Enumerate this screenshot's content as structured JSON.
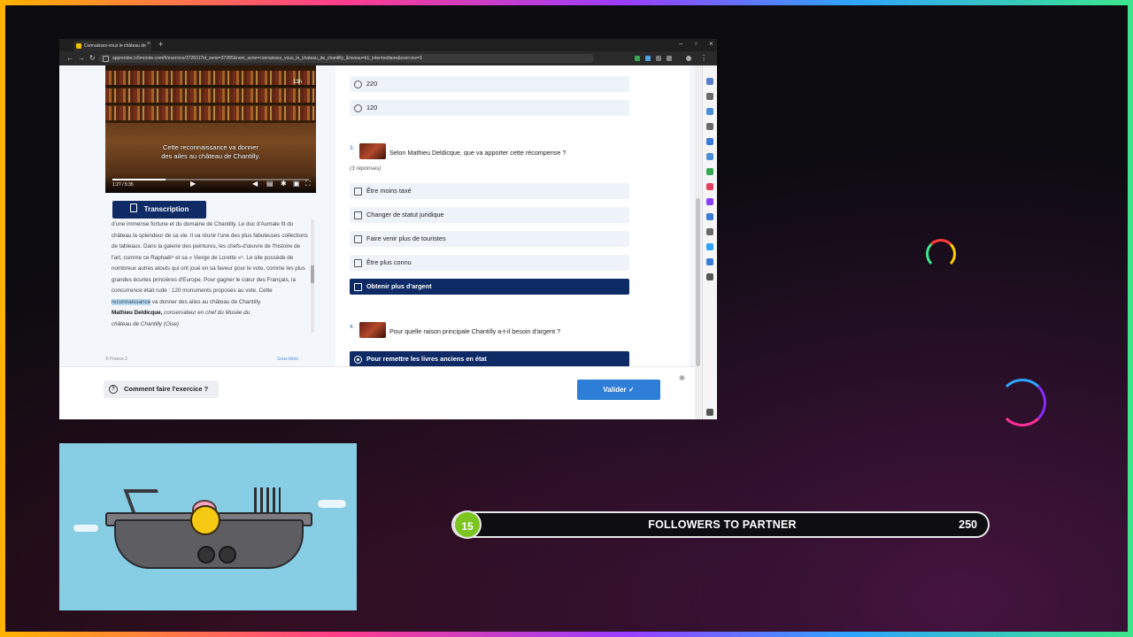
{
  "browser": {
    "tab_title": "Connaissez-vous le château de",
    "url": "apprendre.tv5monde.com/fr/exercice/3728317id_serie=37285&nom_serie=connaissez_vous_le_chateau_de_chantilly_&niveau=b1_intermediaire&exercice=3"
  },
  "video": {
    "subtitle_line1": "Cette reconnaissance va donner",
    "subtitle_line2": "des ailes au château de Chantilly.",
    "time": "1:27 / 5:35",
    "badge": "13h"
  },
  "transcript": {
    "button_label": "Transcription",
    "text_before": "d'une immense fortune et du domaine de Chantilly. Le duc d'Aumale fit du château la splendeur de sa vie. Il va réunir l'une des plus fabuleuses collections de tableaux. Dans la galerie des peintures, les chefs-d'œuvre de l'histoire de l'art, comme ce Raphaël⁴ et sa « Vierge de Lorette »⁵. Le site possède de nombreux autres atouts qui ont joué en sa faveur pour le vote, comme les plus grandes écuries princières d'Europe. Pour gagner le cœur des Français, la concurrence était rude : 120 monuments proposés au vote. Cette",
    "highlight": "reconnaissance",
    "text_after": " va donner des ailes au château de Chantilly.",
    "speaker_name": "Mathieu Deldicque,",
    "speaker_role": " conservateur en chef du Musée du",
    "speaker_role_2": "château de Chantilly (Oise)",
    "copyright": "© France 2",
    "subtitles_link": "Sous-titres"
  },
  "quiz": {
    "prev_options": [
      "220",
      "120"
    ],
    "q3": {
      "number": "3.",
      "text": "Selon Mathieu Deldicque, que va apporter cette récompense ?",
      "hint": "(3 réponses)",
      "options": [
        {
          "label": "Être moins taxé",
          "selected": false
        },
        {
          "label": "Changer de statut juridique",
          "selected": false
        },
        {
          "label": "Faire venir plus de touristes",
          "selected": false
        },
        {
          "label": "Être plus connu",
          "selected": false
        },
        {
          "label": "Obtenir plus d'argent",
          "selected": true
        }
      ]
    },
    "q4": {
      "number": "4.",
      "text": "Pour quelle raison principale Chantilly a-t-il besoin d'argent ?",
      "options": [
        {
          "label": "Pour remettre les livres anciens en état",
          "selected": true
        }
      ]
    }
  },
  "footer": {
    "howto_label": "Comment faire l'exercice ?",
    "valider_label": "Valider ✓"
  },
  "followers": {
    "current": "15",
    "title": "FOLLOWERS TO PARTNER",
    "goal": "250",
    "progress_fraction": 0.06
  }
}
